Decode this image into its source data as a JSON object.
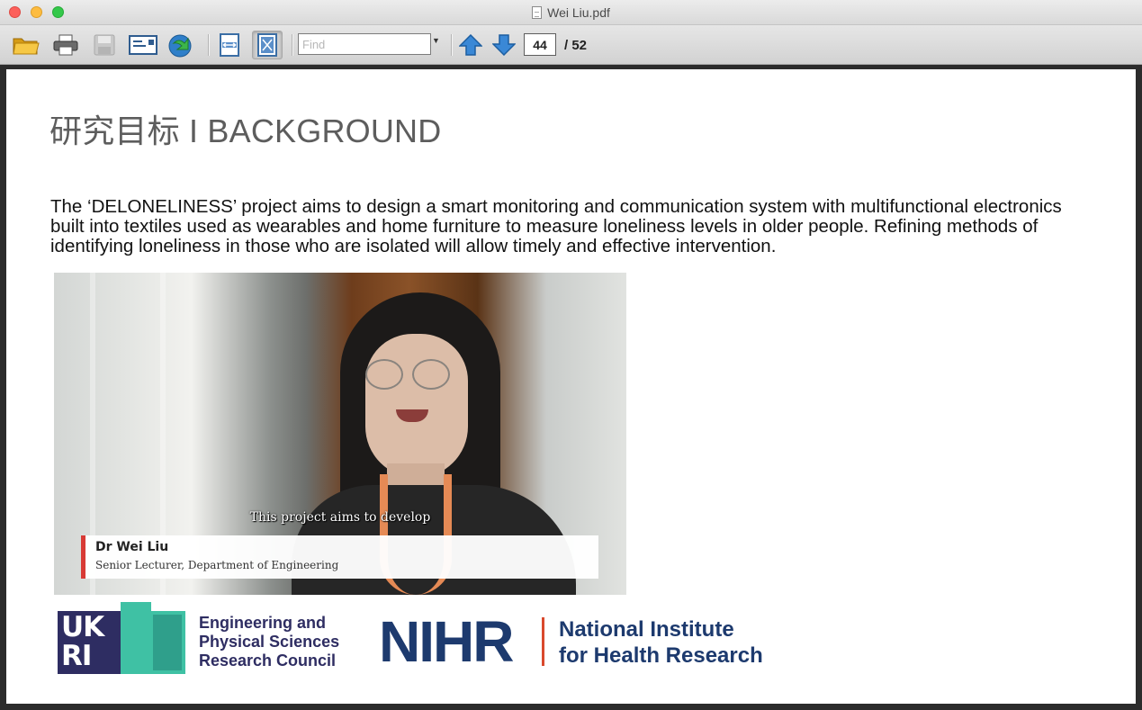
{
  "window": {
    "title": "Wei Liu.pdf"
  },
  "toolbar": {
    "find_placeholder": "Find",
    "current_page": "44",
    "page_total": "/ 52"
  },
  "slide": {
    "title": "研究目标 I BACKGROUND",
    "body": "The ‘DELONELINESS’ project aims to design a smart monitoring and communication system with multifunctional electronics built into textiles used as wearables and home furniture to measure loneliness levels in older people. Refining methods of identifying loneliness in those who are isolated will allow timely and effective intervention.",
    "video": {
      "subtitle": "This project aims to develop",
      "name": "Dr Wei Liu",
      "role": "Senior Lecturer, Department of Engineering"
    },
    "logos": {
      "ukri_lettering": "UK RI",
      "epsrc_line1": "Engineering and",
      "epsrc_line2": "Physical Sciences",
      "epsrc_line3": "Research Council",
      "nihr_mark": "NIHR",
      "nihr_line1": "National Institute",
      "nihr_line2": "for Health Research"
    }
  },
  "colors": {
    "ukri_navy": "#2e2d62",
    "ukri_teal": "#3fc1a4",
    "nihr_blue": "#1d3a6e",
    "nihr_accent": "#d9492d",
    "lower_third_accent": "#d83a35"
  },
  "icons": [
    "open-folder-icon",
    "print-icon",
    "save-icon",
    "email-icon",
    "go-back-icon",
    "fit-width-icon",
    "fit-page-icon",
    "dropdown-arrow-icon",
    "previous-page-icon",
    "next-page-icon"
  ]
}
